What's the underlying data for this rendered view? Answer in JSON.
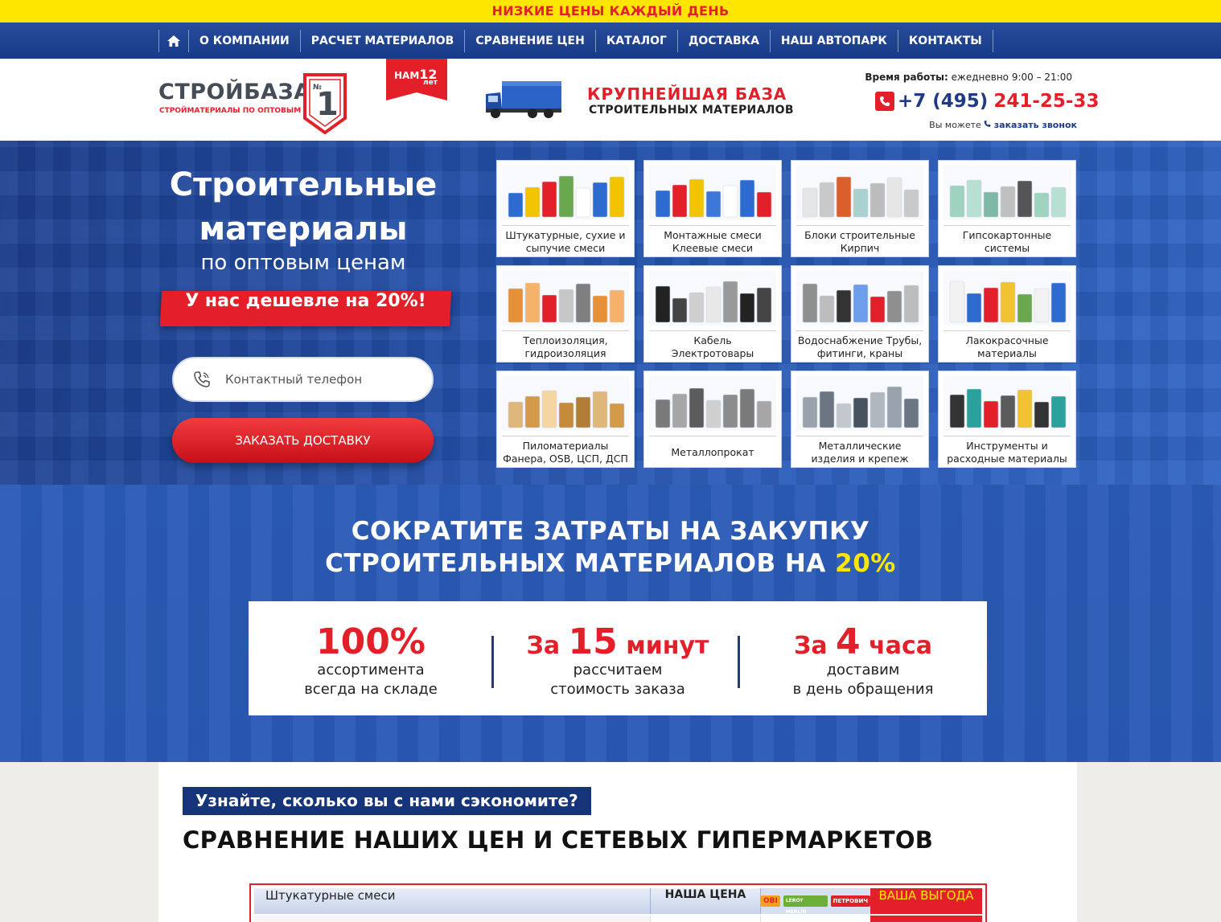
{
  "topbar": {
    "text": "НИЗКИЕ ЦЕНЫ КАЖДЫЙ ДЕНЬ"
  },
  "nav": {
    "home_icon": "home-icon",
    "items": [
      "О КОМПАНИИ",
      "РАСЧЕТ МАТЕРИАЛОВ",
      "СРАВНЕНИЕ ЦЕН",
      "КАТАЛОГ",
      "ДОСТАВКА",
      "НАШ АВТОПАРК",
      "КОНТАКТЫ"
    ]
  },
  "header": {
    "logo_name": "СТРОЙБАЗА",
    "logo_number": "№1",
    "logo_sub": "СТРОЙМАТЕРИАЛЫ ПО ОПТОВЫМ ЦЕНАМ",
    "ribbon_prefix": "НАМ",
    "ribbon_number": "12",
    "ribbon_suffix": "лет",
    "slogan_line1": "КРУПНЕЙШАЯ БАЗА",
    "slogan_line2": "СТРОИТЕЛЬНЫХ МАТЕРИАЛОВ",
    "hours_label": "Время работы:",
    "hours_value": "ежедневно 9:00 – 21:00",
    "phone_code": "+7 (495)",
    "phone_number": "241-25-33",
    "callback_prefix": "Вы можете",
    "callback_link": "заказать звонок"
  },
  "hero": {
    "title_line1": "Строительные",
    "title_line2": "материалы",
    "subtitle": "по оптовым ценам",
    "badge": "У нас дешевле на 20%!",
    "phone_placeholder": "Контактный телефон",
    "order_button": "ЗАКАЗАТЬ ДОСТАВКУ"
  },
  "categories": [
    {
      "line1": "Штукатурные, сухие и",
      "line2": "сыпучие смеси"
    },
    {
      "line1": "Монтажные смеси",
      "line2": "Клеевые смеси"
    },
    {
      "line1": "Блоки строительные",
      "line2": "Кирпич"
    },
    {
      "line1": "Гипсокартонные",
      "line2": "системы"
    },
    {
      "line1": "Теплоизоляция,",
      "line2": "гидроизоляция"
    },
    {
      "line1": "Кабель",
      "line2": "Электротовары"
    },
    {
      "line1": "Водоснабжение Трубы,",
      "line2": "фитинги, краны"
    },
    {
      "line1": "Лакокрасочные",
      "line2": "материалы"
    },
    {
      "line1": "Пиломатериалы",
      "line2": "Фанера, OSB, ЦСП, ДСП"
    },
    {
      "line1": "Металлопрокат",
      "line2": ""
    },
    {
      "line1": "Металлические",
      "line2": "изделия и крепеж"
    },
    {
      "line1": "Инструменты и",
      "line2": "расходные материалы"
    }
  ],
  "savings": {
    "title_line1": "СОКРАТИТЕ ЗАТРАТЫ НА ЗАКУПКУ",
    "title_line2_prefix": "СТРОИТЕЛЬНЫХ МАТЕРИАЛОВ НА",
    "title_highlight": "20%",
    "stats": [
      {
        "pre": "",
        "num": "100%",
        "post": "",
        "line1": "ассортимента",
        "line2": "всегда на складе"
      },
      {
        "pre": "За",
        "num": "15",
        "post": "минут",
        "line1": "рассчитаем",
        "line2": "стоимость заказа"
      },
      {
        "pre": "За",
        "num": "4",
        "post": "часа",
        "line1": "доставим",
        "line2": "в день обращения"
      }
    ]
  },
  "compare": {
    "tag": "Узнайте, сколько вы с нами сэкономите?",
    "title": "СРАВНЕНИЕ НАШИХ ЦЕН И СЕТЕВЫХ ГИПЕРМАРКЕТОВ",
    "table_headers": {
      "product": "Штукатурные смеси",
      "our_price": "НАША ЦЕНА",
      "stores": [
        "OBI",
        "LEROY MERLIN",
        "ПЕТРОВИЧ"
      ],
      "benefit": "ВАША ВЫГОДА"
    }
  },
  "colors": {
    "brand_blue": "#1f3b84",
    "accent_red": "#e3202a",
    "accent_yellow": "#ffe600"
  }
}
